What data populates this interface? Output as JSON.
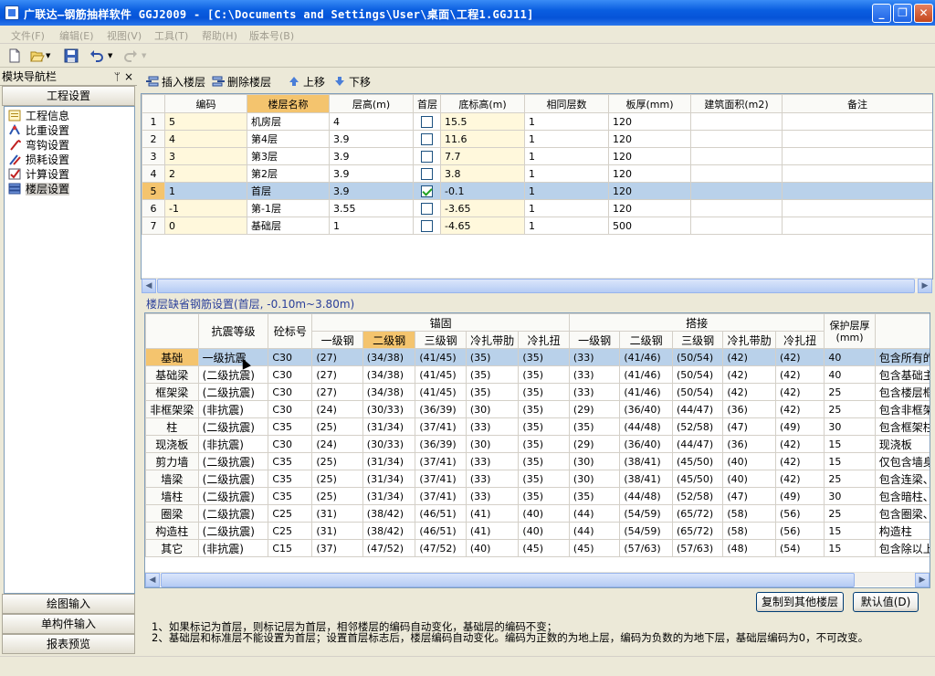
{
  "window": {
    "title": "广联达—钢筋抽样软件 GGJ2009 - [C:\\Documents and Settings\\User\\桌面\\工程1.GGJ11]",
    "controls": [
      "_",
      "❐",
      "✕"
    ]
  },
  "menu": [
    "文件(F)",
    "编辑(E)",
    "视图(V)",
    "工具(T)",
    "帮助(H)",
    "版本号(B)"
  ],
  "left_panel": {
    "title": "模块导航栏",
    "pin": "ᛘ",
    "close": "×",
    "section_top": "工程设置",
    "nav_items": [
      {
        "label": "工程信息",
        "icon": "info-icon"
      },
      {
        "label": "比重设置",
        "icon": "weight-icon"
      },
      {
        "label": "弯钩设置",
        "icon": "hook-icon"
      },
      {
        "label": "损耗设置",
        "icon": "loss-icon"
      },
      {
        "label": "计算设置",
        "icon": "calc-icon"
      },
      {
        "label": "楼层设置",
        "icon": "floor-icon",
        "selected": true
      }
    ],
    "bottom_sections": [
      "绘图输入",
      "单构件输入",
      "报表预览"
    ]
  },
  "floor_toolbar": {
    "insert": "插入楼层",
    "delete": "删除楼层",
    "up": "上移",
    "down": "下移"
  },
  "floor_table": {
    "headers": [
      "编码",
      "楼层名称",
      "层高(m)",
      "首层",
      "底标高(m)",
      "相同层数",
      "板厚(mm)",
      "建筑面积(m2)",
      "备注"
    ],
    "rows": [
      {
        "n": "1",
        "code": "5",
        "name": "机房层",
        "height": "4",
        "first": false,
        "bottom": "15.5",
        "same": "1",
        "slab": "120",
        "area": "",
        "note": ""
      },
      {
        "n": "2",
        "code": "4",
        "name": "第4层",
        "height": "3.9",
        "first": false,
        "bottom": "11.6",
        "same": "1",
        "slab": "120",
        "area": "",
        "note": ""
      },
      {
        "n": "3",
        "code": "3",
        "name": "第3层",
        "height": "3.9",
        "first": false,
        "bottom": "7.7",
        "same": "1",
        "slab": "120",
        "area": "",
        "note": ""
      },
      {
        "n": "4",
        "code": "2",
        "name": "第2层",
        "height": "3.9",
        "first": false,
        "bottom": "3.8",
        "same": "1",
        "slab": "120",
        "area": "",
        "note": ""
      },
      {
        "n": "5",
        "code": "1",
        "name": "首层",
        "height": "3.9",
        "first": true,
        "bottom": "-0.1",
        "same": "1",
        "slab": "120",
        "area": "",
        "note": "",
        "selected": true
      },
      {
        "n": "6",
        "code": "-1",
        "name": "第-1层",
        "height": "3.55",
        "first": false,
        "bottom": "-3.65",
        "same": "1",
        "slab": "120",
        "area": "",
        "note": ""
      },
      {
        "n": "7",
        "code": "0",
        "name": "基础层",
        "height": "1",
        "first": false,
        "bottom": "-4.65",
        "same": "1",
        "slab": "500",
        "area": "",
        "note": ""
      }
    ]
  },
  "rebar_section": {
    "label": "楼层缺省钢筋设置(首层, -0.10m~3.80m)",
    "header_group": {
      "seismic": "抗震等级",
      "concrete": "砼标号",
      "anchor": "锚固",
      "lap": "搭接",
      "cover": "保护层厚(mm)"
    },
    "subheaders": [
      "一级钢",
      "二级钢",
      "三级钢",
      "冷扎带肋",
      "冷扎扭"
    ],
    "rows": [
      {
        "name": "基础",
        "seismic": "一级抗震",
        "conc": "C30",
        "anchor": [
          "(27)",
          "(34/38)",
          "(41/45)",
          "(35)",
          "(35)"
        ],
        "lap": [
          "(33)",
          "(41/46)",
          "(50/54)",
          "(42)",
          "(42)"
        ],
        "cover": "40",
        "note": "包含所有的基础构件",
        "selected": true
      },
      {
        "name": "基础梁",
        "seismic": "(二级抗震)",
        "conc": "C30",
        "anchor": [
          "(27)",
          "(34/38)",
          "(41/45)",
          "(35)",
          "(35)"
        ],
        "lap": [
          "(33)",
          "(41/46)",
          "(50/54)",
          "(42)",
          "(42)"
        ],
        "cover": "40",
        "note": "包含基础主梁和基础"
      },
      {
        "name": "框架梁",
        "seismic": "(二级抗震)",
        "conc": "C30",
        "anchor": [
          "(27)",
          "(34/38)",
          "(41/45)",
          "(35)",
          "(35)"
        ],
        "lap": [
          "(33)",
          "(41/46)",
          "(50/54)",
          "(42)",
          "(42)"
        ],
        "cover": "25",
        "note": "包含楼层框架梁、屋"
      },
      {
        "name": "非框架梁",
        "seismic": "(非抗震)",
        "conc": "C30",
        "anchor": [
          "(24)",
          "(30/33)",
          "(36/39)",
          "(30)",
          "(35)"
        ],
        "lap": [
          "(29)",
          "(36/40)",
          "(44/47)",
          "(36)",
          "(42)"
        ],
        "cover": "25",
        "note": "包含非框架梁、井字"
      },
      {
        "name": "柱",
        "seismic": "(二级抗震)",
        "conc": "C35",
        "anchor": [
          "(25)",
          "(31/34)",
          "(37/41)",
          "(33)",
          "(35)"
        ],
        "lap": [
          "(35)",
          "(44/48)",
          "(52/58)",
          "(47)",
          "(49)"
        ],
        "cover": "30",
        "note": "包含框架柱、框支柱"
      },
      {
        "name": "现浇板",
        "seismic": "(非抗震)",
        "conc": "C30",
        "anchor": [
          "(24)",
          "(30/33)",
          "(36/39)",
          "(30)",
          "(35)"
        ],
        "lap": [
          "(29)",
          "(36/40)",
          "(44/47)",
          "(36)",
          "(42)"
        ],
        "cover": "15",
        "note": "现浇板"
      },
      {
        "name": "剪力墙",
        "seismic": "(二级抗震)",
        "conc": "C35",
        "anchor": [
          "(25)",
          "(31/34)",
          "(37/41)",
          "(33)",
          "(35)"
        ],
        "lap": [
          "(30)",
          "(38/41)",
          "(45/50)",
          "(40)",
          "(42)"
        ],
        "cover": "15",
        "note": "仅包含墙身"
      },
      {
        "name": "墙梁",
        "seismic": "(二级抗震)",
        "conc": "C35",
        "anchor": [
          "(25)",
          "(31/34)",
          "(37/41)",
          "(33)",
          "(35)"
        ],
        "lap": [
          "(30)",
          "(38/41)",
          "(45/50)",
          "(40)",
          "(42)"
        ],
        "cover": "25",
        "note": "包含连梁、暗梁、边"
      },
      {
        "name": "墙柱",
        "seismic": "(二级抗震)",
        "conc": "C35",
        "anchor": [
          "(25)",
          "(31/34)",
          "(37/41)",
          "(33)",
          "(35)"
        ],
        "lap": [
          "(35)",
          "(44/48)",
          "(52/58)",
          "(47)",
          "(49)"
        ],
        "cover": "30",
        "note": "包含暗柱、端柱"
      },
      {
        "name": "圈梁",
        "seismic": "(二级抗震)",
        "conc": "C25",
        "anchor": [
          "(31)",
          "(38/42)",
          "(46/51)",
          "(41)",
          "(40)"
        ],
        "lap": [
          "(44)",
          "(54/59)",
          "(65/72)",
          "(58)",
          "(56)"
        ],
        "cover": "25",
        "note": "包含圈梁、过梁"
      },
      {
        "name": "构造柱",
        "seismic": "(二级抗震)",
        "conc": "C25",
        "anchor": [
          "(31)",
          "(38/42)",
          "(46/51)",
          "(41)",
          "(40)"
        ],
        "lap": [
          "(44)",
          "(54/59)",
          "(65/72)",
          "(58)",
          "(56)"
        ],
        "cover": "15",
        "note": "构造柱"
      },
      {
        "name": "其它",
        "seismic": "(非抗震)",
        "conc": "C15",
        "anchor": [
          "(37)",
          "(47/52)",
          "(47/52)",
          "(40)",
          "(45)"
        ],
        "lap": [
          "(45)",
          "(57/63)",
          "(57/63)",
          "(48)",
          "(54)"
        ],
        "cover": "15",
        "note": "包含除以上构件类型"
      }
    ]
  },
  "buttons": {
    "copy": "复制到其他楼层",
    "default": "默认值(D)"
  },
  "notes": [
    "1、如果标记为首层，则标记层为首层，相邻楼层的编码自动变化，基础层的编码不变；",
    "2、基础层和标准层不能设置为首层；设置首层标志后，楼层编码自动变化。编码为正数的为地上层，编码为负数的为地下层，基础层编码为0，不可改变。"
  ],
  "colors": {
    "selected_row": "#b9d1ea",
    "highlight_header": "#f4c46e",
    "titlebar": "#0a5ee0"
  }
}
